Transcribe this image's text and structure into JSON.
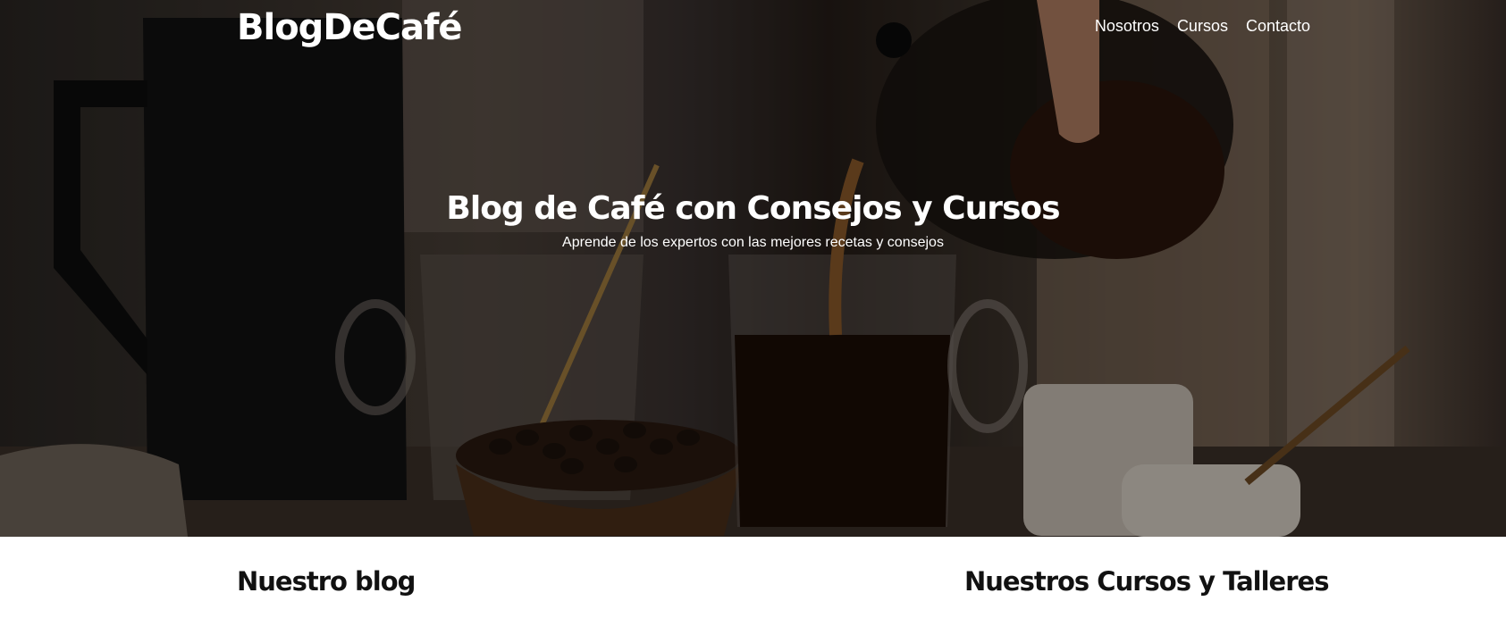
{
  "header": {
    "brand": "BlogDeCafé",
    "nav": [
      {
        "label": "Nosotros"
      },
      {
        "label": "Cursos"
      },
      {
        "label": "Contacto"
      }
    ]
  },
  "hero": {
    "title": "Blog de Café con Consejos y Cursos",
    "subtitle": "Aprende de los expertos con las mejores recetas y consejos",
    "image": "coffee-pouring-photo"
  },
  "sections": {
    "blog_title": "Nuestro blog",
    "courses_title": "Nuestros Cursos y Talleres"
  }
}
